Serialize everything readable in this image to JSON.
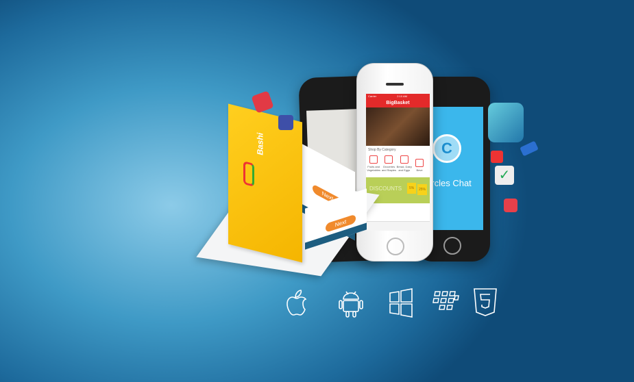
{
  "left_phone": {
    "app": "BigBasket",
    "status_carrier": "Carrier",
    "status_time": "2:10 AM",
    "section": "Shop By Category",
    "categories": [
      "Fruits and Vegetables",
      "Groceries and Staples",
      "Bread, Dairy and Eggs",
      "Beve"
    ],
    "banner": "DISCOUNTS",
    "tags": [
      "5%",
      "25%"
    ]
  },
  "right_phone": {
    "app": "Circles Chat",
    "icon": "phone-chat-bubble-icon"
  },
  "tablet": {
    "app": "Bashi",
    "buttons": [
      "Next",
      "Next"
    ]
  },
  "platforms": [
    "apple-icon",
    "android-icon",
    "windows-icon",
    "blackberry-icon",
    "html5-icon"
  ],
  "colors": {
    "background": "#3f9ac6",
    "bigbasket_red": "#e32a2a",
    "circles_blue": "#3bb7ec",
    "bashi_yellow": "#ffcf1f",
    "button_orange": "#f08a2c"
  }
}
